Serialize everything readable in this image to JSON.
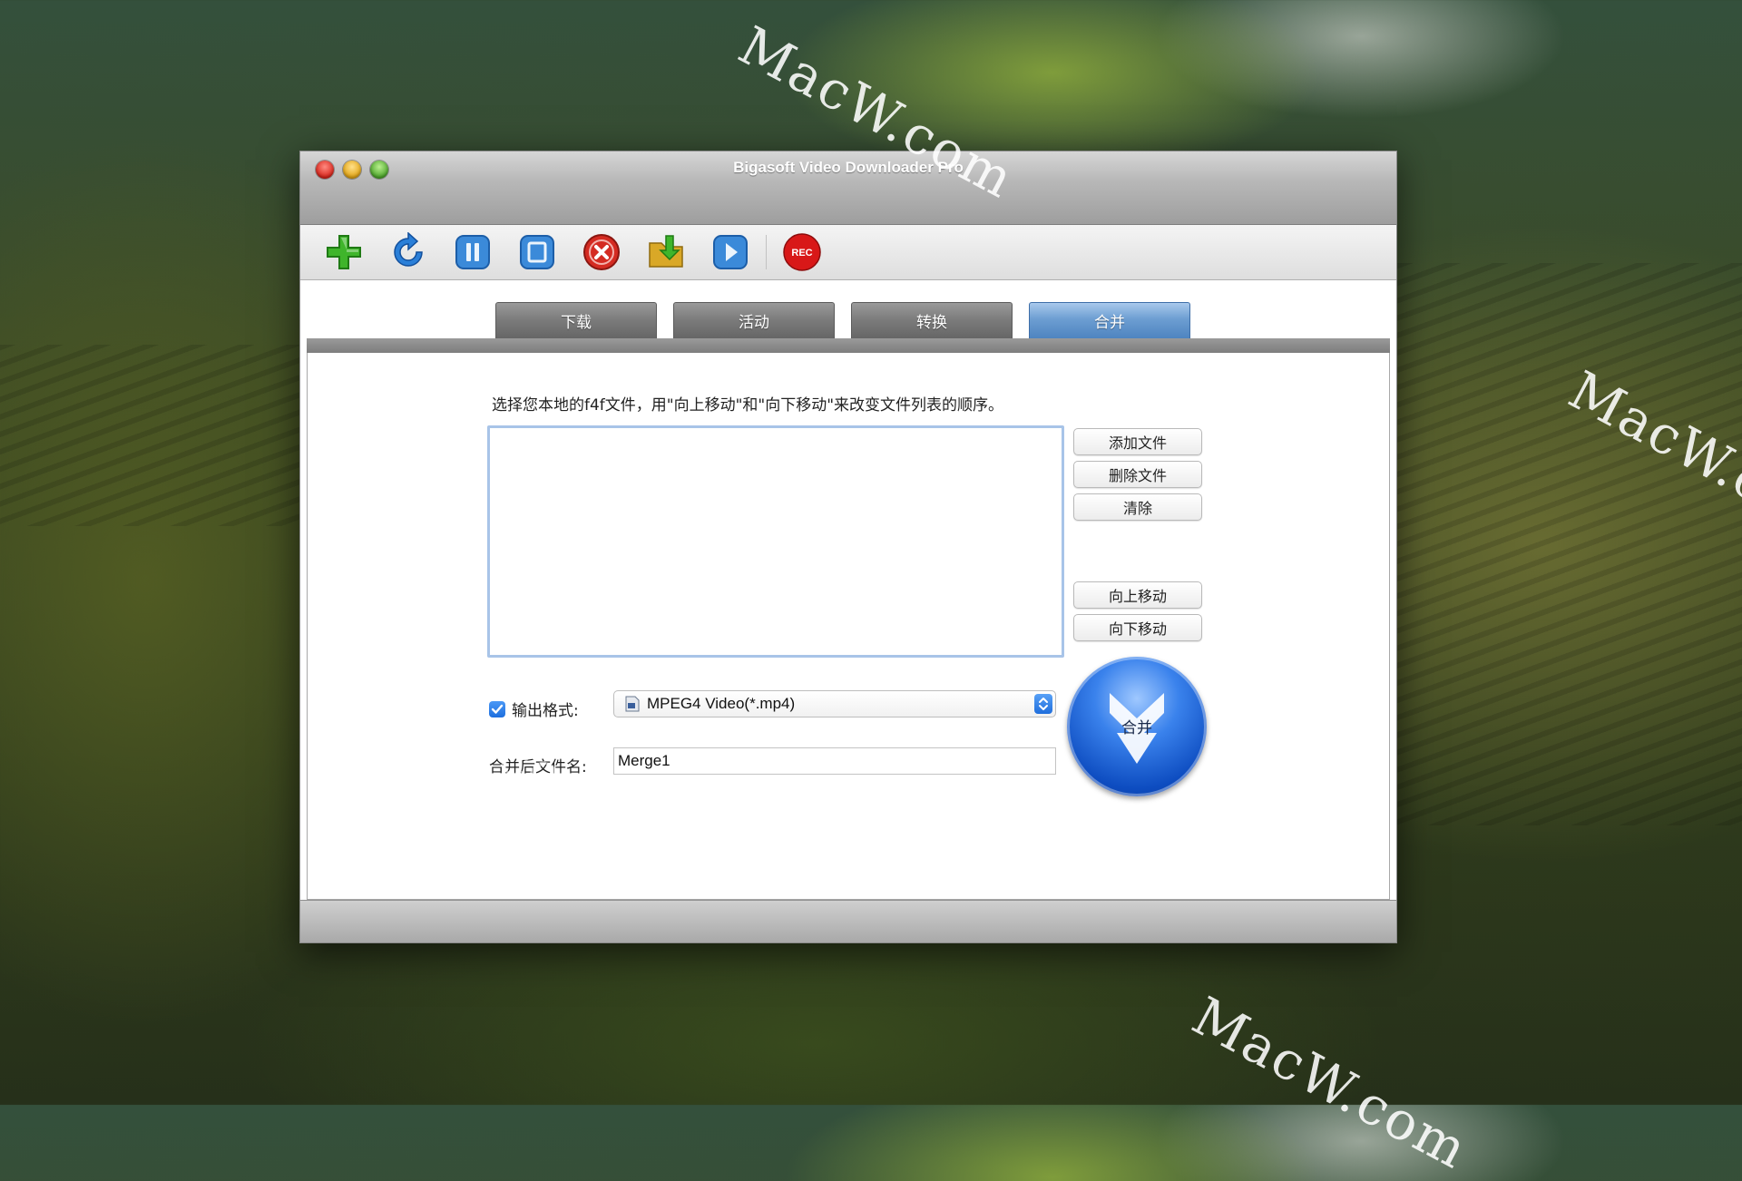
{
  "desktop": {
    "watermark": "MacW.com"
  },
  "window": {
    "title": "Bigasoft Video Downloader Pro"
  },
  "toolbar": {
    "buttons": [
      {
        "icon": "add-icon"
      },
      {
        "icon": "refresh-icon"
      },
      {
        "icon": "pause-icon"
      },
      {
        "icon": "stop-icon"
      },
      {
        "icon": "delete-icon"
      },
      {
        "icon": "open-folder-icon"
      },
      {
        "icon": "play-icon"
      },
      {
        "icon": "record-icon",
        "label": "REC"
      }
    ]
  },
  "tabs": [
    {
      "label": "下载",
      "active": false
    },
    {
      "label": "活动",
      "active": false
    },
    {
      "label": "转换",
      "active": false
    },
    {
      "label": "合并",
      "active": true
    }
  ],
  "merge": {
    "instruction": "选择您本地的f4f文件，用\"向上移动\"和\"向下移动\"来改变文件列表的顺序。",
    "buttons": {
      "add_file": "添加文件",
      "delete_file": "删除文件",
      "clear": "清除",
      "move_up": "向上移动",
      "move_down": "向下移动"
    },
    "output_format_label": "输出格式:",
    "output_format_checked": true,
    "output_format_value": "MPEG4 Video(*.mp4)",
    "filename_label": "合并后文件名:",
    "filename_value": "Merge1",
    "merge_button_label": "合并"
  },
  "colors": {
    "tab_active": "#4e84c0",
    "tab_inactive": "#7a7a7a",
    "merge_button": "#1f5fd6",
    "rec_button": "#d81818"
  }
}
